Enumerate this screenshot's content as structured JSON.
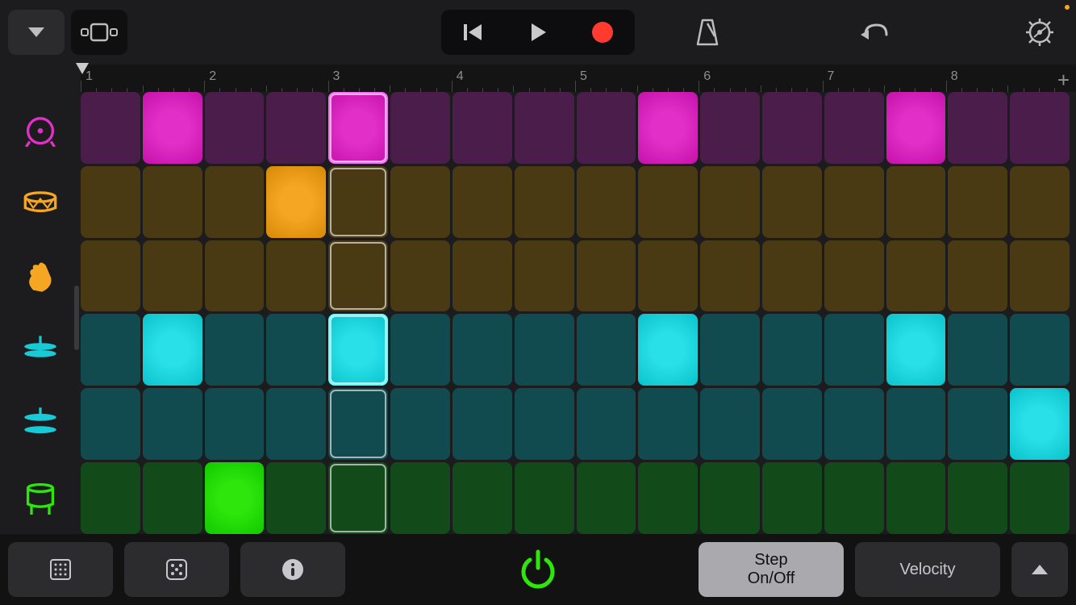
{
  "topbar": {
    "playing": false,
    "recording": false
  },
  "ruler": {
    "bars": [
      1,
      2,
      3,
      4,
      5,
      6,
      7,
      8
    ],
    "playhead_bar": 1,
    "add_label": "+"
  },
  "playhead_step": 5,
  "tracks": [
    {
      "name": "kick",
      "icon_color": "#e22fc7",
      "base": "#4a1d4a",
      "active": "#e22fc7",
      "steps": [
        0,
        1,
        0,
        0,
        1,
        0,
        0,
        0,
        0,
        1,
        0,
        0,
        0,
        1,
        0,
        0
      ]
    },
    {
      "name": "snare",
      "icon_color": "#f5a623",
      "base": "#4a3a14",
      "active": "#f5a623",
      "steps": [
        0,
        0,
        0,
        1,
        0,
        0,
        0,
        0,
        0,
        0,
        0,
        0,
        0,
        0,
        0,
        0
      ]
    },
    {
      "name": "clap",
      "icon_color": "#f5a623",
      "base": "#4a3a14",
      "active": "#f5a623",
      "steps": [
        0,
        0,
        0,
        0,
        0,
        0,
        0,
        0,
        0,
        0,
        0,
        0,
        0,
        0,
        0,
        0
      ]
    },
    {
      "name": "closed-hat",
      "icon_color": "#18c9d6",
      "base": "#114b4f",
      "active": "#29e0e8",
      "steps": [
        0,
        1,
        0,
        0,
        1,
        0,
        0,
        0,
        0,
        1,
        0,
        0,
        0,
        1,
        0,
        0
      ]
    },
    {
      "name": "open-hat",
      "icon_color": "#18c9d6",
      "base": "#114b4f",
      "active": "#29e0e8",
      "steps": [
        0,
        0,
        0,
        0,
        0,
        0,
        0,
        0,
        0,
        0,
        0,
        0,
        0,
        0,
        0,
        1
      ]
    },
    {
      "name": "tom",
      "icon_color": "#2ee60b",
      "base": "#134a1a",
      "active": "#2ee60b",
      "steps": [
        0,
        0,
        1,
        0,
        0,
        0,
        0,
        0,
        0,
        0,
        0,
        0,
        0,
        0,
        0,
        0
      ]
    }
  ],
  "footer": {
    "step_label_1": "Step",
    "step_label_2": "On/Off",
    "velocity_label": "Velocity"
  }
}
